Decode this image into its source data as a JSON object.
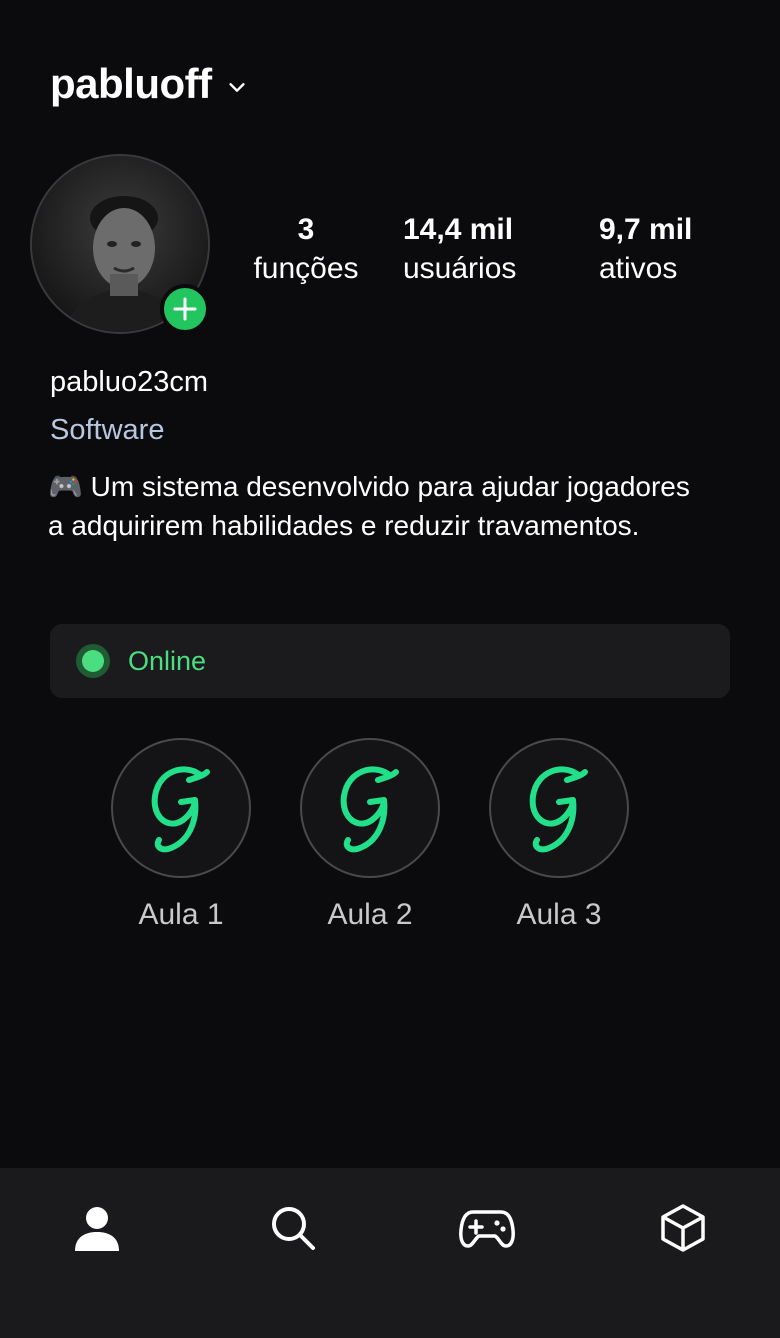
{
  "header": {
    "username": "pabluoff"
  },
  "stats": [
    {
      "value": "3",
      "label": "funções"
    },
    {
      "value": "14,4 mil",
      "label": "usuários"
    },
    {
      "value": "9,7 mil",
      "label": "ativos"
    }
  ],
  "profile": {
    "name": "pabluo23cm",
    "category": "Software",
    "bio": "🎮 Um sistema desenvolvido para ajudar jogadores a adquirirem habilidades e reduzir travamentos."
  },
  "status": {
    "label": "Online",
    "color": "#4ade80"
  },
  "highlights": [
    {
      "label": "Aula 1",
      "icon": "g-logo-icon"
    },
    {
      "label": "Aula 2",
      "icon": "g-logo-icon"
    },
    {
      "label": "Aula 3",
      "icon": "g-logo-icon"
    }
  ],
  "bottom_nav": [
    {
      "icon": "user-icon",
      "active": true
    },
    {
      "icon": "search-icon",
      "active": false
    },
    {
      "icon": "gamepad-icon",
      "active": false
    },
    {
      "icon": "cube-icon",
      "active": false
    }
  ],
  "colors": {
    "accent": "#22c55e",
    "background": "#0b0b0d",
    "card": "#1b1b1d"
  }
}
